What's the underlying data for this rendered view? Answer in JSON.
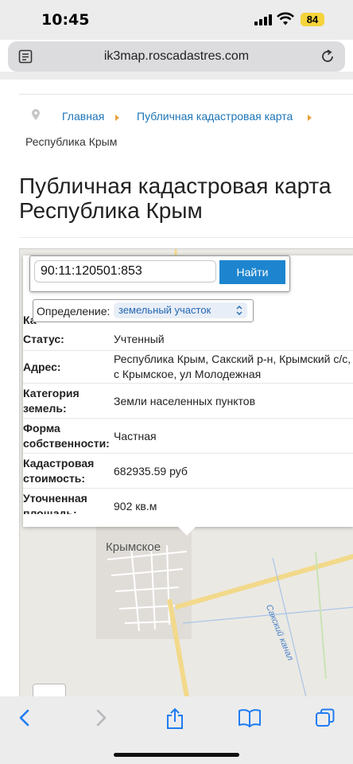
{
  "status_bar": {
    "time": "10:45",
    "battery": "84"
  },
  "browser": {
    "url": "ik3map.roscadastres.com"
  },
  "breadcrumb": {
    "items": [
      "Главная",
      "Публичная кадастровая карта"
    ],
    "current": "Республика Крым"
  },
  "page": {
    "title_line1": "Публичная кадастровая карта",
    "title_line2": "Республика Крым"
  },
  "search": {
    "value": "90:11:120501:853",
    "button_label": "Найти"
  },
  "definition": {
    "label": "Определение:",
    "selected": "земельный участок"
  },
  "info": {
    "partial_label": "Ка",
    "rows": [
      {
        "label": "Статус:",
        "value": "Учтенный"
      },
      {
        "label": "Адрес:",
        "value": "Республика Крым, Сакский р-н, Крымский с/с, с Крымское, ул Молодежная"
      },
      {
        "label": "Категория земель:",
        "value": "Земли населенных пунктов"
      },
      {
        "label": "Форма собственности:",
        "value": "Частная"
      },
      {
        "label": "Кадастровая стоимость:",
        "value": "682935.59 руб"
      },
      {
        "label": "Уточненная площадь:",
        "value": "902 кв.м"
      }
    ]
  },
  "map": {
    "village_label": "Крымское",
    "canal_label": "Сакский канал"
  },
  "colors": {
    "link": "#1d74b7",
    "button": "#1d85cf",
    "battery": "#f4d33b",
    "accent_arrow": "#e9a23b",
    "toolbar_icons": "#1f7cf2"
  },
  "icons": [
    "reader-icon",
    "reload-icon",
    "location-pin-icon",
    "chevron-updown-icon",
    "back-icon",
    "forward-icon",
    "share-icon",
    "bookmarks-icon",
    "tabs-icon"
  ]
}
